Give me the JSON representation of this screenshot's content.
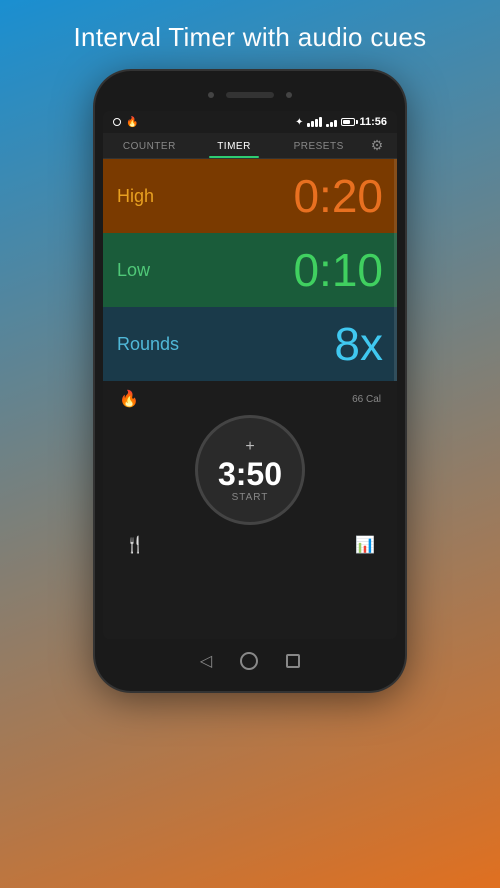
{
  "header": {
    "title": "Interval Timer with audio cues"
  },
  "status_bar": {
    "time": "11:56",
    "icons": [
      "circle-icon",
      "fire-icon",
      "bluetooth-icon",
      "wifi-icon",
      "signal-icon",
      "battery-icon"
    ]
  },
  "tabs": [
    {
      "id": "counter",
      "label": "COUNTER",
      "active": false
    },
    {
      "id": "timer",
      "label": "TIMER",
      "active": true
    },
    {
      "id": "presets",
      "label": "PRESETS",
      "active": false
    }
  ],
  "intervals": [
    {
      "id": "high",
      "label": "High",
      "value": "0:20",
      "theme": "high"
    },
    {
      "id": "low",
      "label": "Low",
      "value": "0:10",
      "theme": "low"
    },
    {
      "id": "rounds",
      "label": "Rounds",
      "value": "8x",
      "theme": "rounds"
    }
  ],
  "calories": {
    "value": "66 Cal"
  },
  "timer": {
    "plus_label": "+",
    "time": "3:50",
    "start_label": "START"
  },
  "bottom_nav": {
    "items": [
      "utensils-icon",
      "chart-icon"
    ]
  },
  "phone_nav": {
    "back_label": "◁",
    "home_label": "",
    "recent_label": ""
  }
}
